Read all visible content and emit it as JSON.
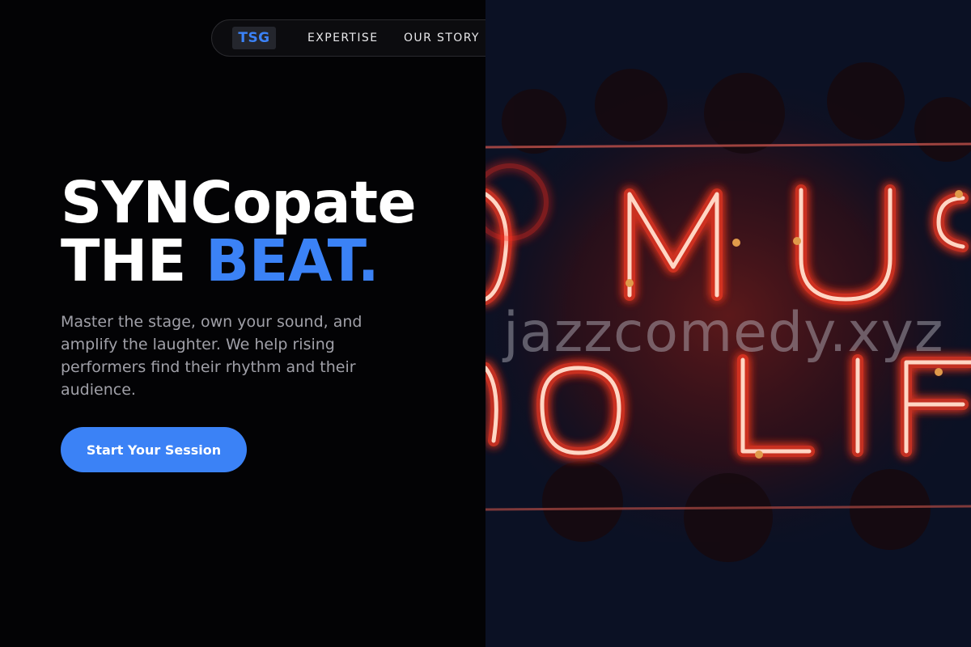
{
  "nav": {
    "logo": "TSG",
    "links": [
      {
        "label": "EXPERTISE"
      },
      {
        "label": "OUR STORY"
      }
    ]
  },
  "hero": {
    "headline_line1": "SYNCopate",
    "headline_line2_prefix": "THE ",
    "headline_line2_accent": "BEAT",
    "headline_line2_suffix": ".",
    "description": "Master the stage, own your sound, and amplify the laughter. We help rising performers find their rhythm and their audience.",
    "cta_label": "Start Your Session"
  },
  "image": {
    "watermark": "jazzcomedy.xyz"
  },
  "colors": {
    "accent": "#3b82f6",
    "background": "#030305",
    "text_muted": "#a0a0a8",
    "neon": "#ff4a2e"
  }
}
